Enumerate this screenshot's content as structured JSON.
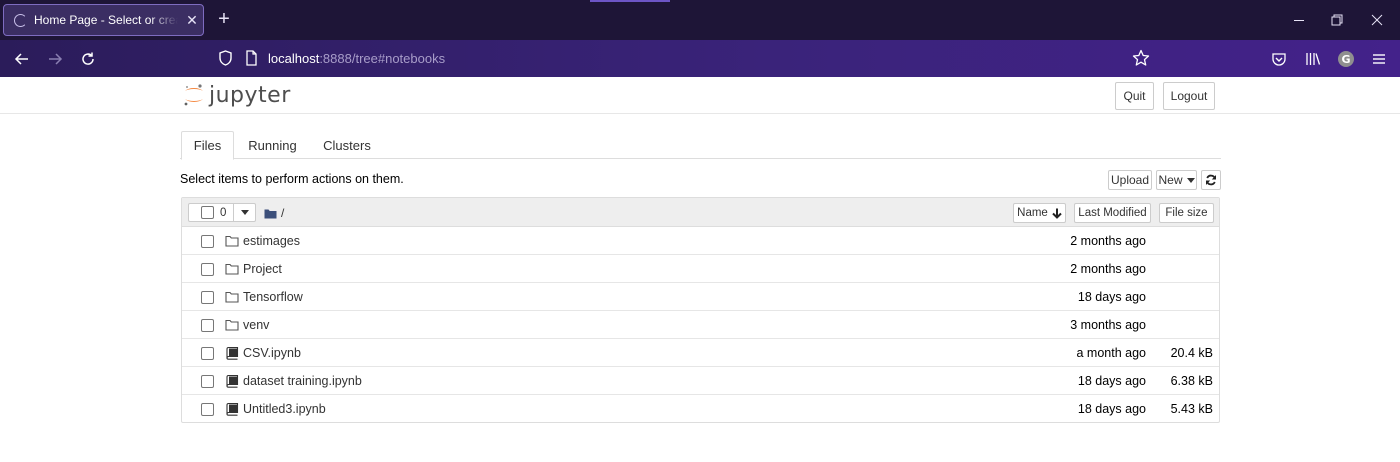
{
  "browser": {
    "tab_title": "Home Page - Select or create a notebook",
    "tab_close": "✕",
    "new_tab": "+",
    "url_host": "localhost",
    "url_rest": ":8888/tree#notebooks"
  },
  "header": {
    "logo_text": "jupyter",
    "quit_label": "Quit",
    "logout_label": "Logout"
  },
  "tabs": [
    {
      "label": "Files"
    },
    {
      "label": "Running"
    },
    {
      "label": "Clusters"
    }
  ],
  "toolbar": {
    "instructions": "Select items to perform actions on them.",
    "upload_label": "Upload",
    "new_label": "New"
  },
  "list_header": {
    "selected_count": "0",
    "breadcrumb": "/",
    "name_label": "Name",
    "last_modified_label": "Last Modified",
    "file_size_label": "File size"
  },
  "files": [
    {
      "name": "estimages",
      "type": "folder",
      "modified": "2 months ago",
      "size": ""
    },
    {
      "name": "Project",
      "type": "folder",
      "modified": "2 months ago",
      "size": ""
    },
    {
      "name": "Tensorflow",
      "type": "folder",
      "modified": "18 days ago",
      "size": ""
    },
    {
      "name": "venv",
      "type": "folder",
      "modified": "3 months ago",
      "size": ""
    },
    {
      "name": "CSV.ipynb",
      "type": "notebook",
      "modified": "a month ago",
      "size": "20.4 kB"
    },
    {
      "name": "dataset training.ipynb",
      "type": "notebook",
      "modified": "18 days ago",
      "size": "6.38 kB"
    },
    {
      "name": "Untitled3.ipynb",
      "type": "notebook",
      "modified": "18 days ago",
      "size": "5.43 kB"
    }
  ],
  "colors": {
    "browser_tabbar": "#1e1537",
    "browser_navbar": "#3a237a",
    "jupyter_orange": "#f37726",
    "text": "#333333"
  }
}
